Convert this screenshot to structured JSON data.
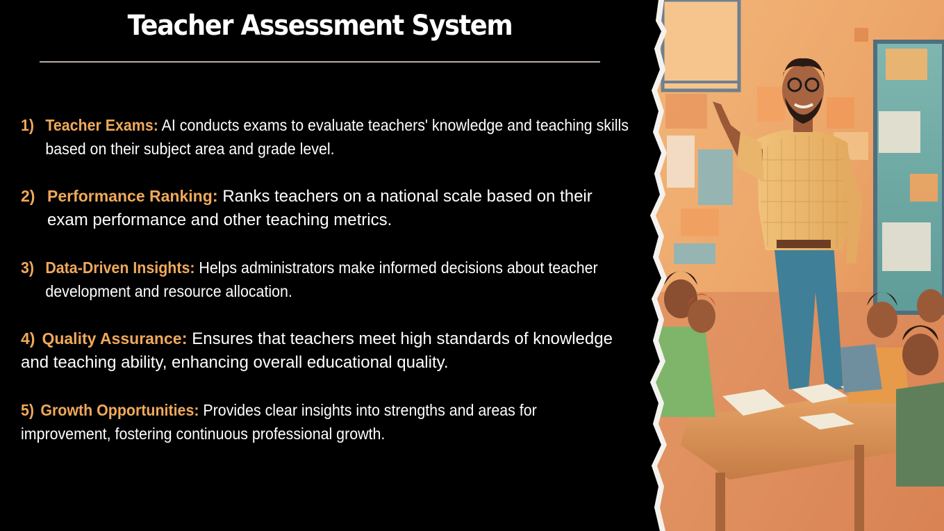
{
  "slide": {
    "title": "Teacher Assessment System",
    "points": [
      {
        "number": "1)",
        "heading": "Teacher Exams",
        "separator": ":",
        "text": " AI conducts exams to evaluate teachers' knowledge and teaching skills based on their subject area and grade level."
      },
      {
        "number": "2)",
        "heading": "Performance Ranking",
        "separator": ":",
        "text": " Ranks teachers on a national scale based on their exam performance and other teaching metrics."
      },
      {
        "number": "3)",
        "heading": "Data-Driven Insights",
        "separator": ":",
        "text": " Helps administrators make informed decisions about teacher development and resource allocation."
      },
      {
        "number": "4)",
        "heading": "Quality Assurance",
        "separator": ":",
        "text": " Ensures that teachers meet high standards of knowledge and teaching ability, enhancing overall educational quality."
      },
      {
        "number": "5)",
        "heading": "Growth Opportunities",
        "separator": ":",
        "text": " Provides clear insights into strengths and areas for improvement, fostering continuous professional growth."
      }
    ]
  },
  "colors": {
    "background": "#000000",
    "heading_accent": "#f0a95a",
    "body_text": "#ffffff",
    "divider": "#b9aea6"
  }
}
